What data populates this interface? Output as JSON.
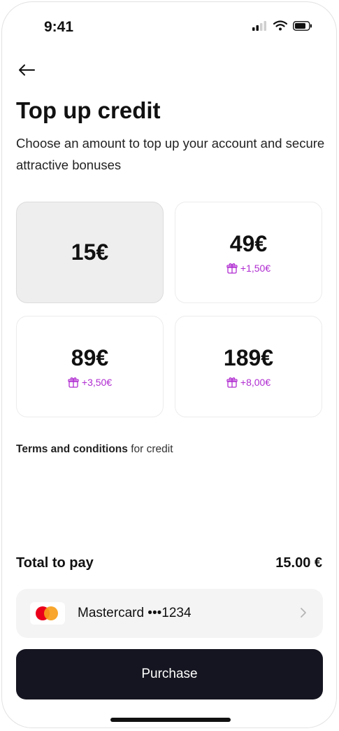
{
  "status_bar": {
    "time": "9:41"
  },
  "header": {
    "title": "Top up credit",
    "subtitle": "Choose an amount to top up your account and secure attractive bonuses"
  },
  "options": [
    {
      "amount": "15€",
      "bonus": "",
      "selected": true
    },
    {
      "amount": "49€",
      "bonus": "+1,50€",
      "selected": false
    },
    {
      "amount": "89€",
      "bonus": "+3,50€",
      "selected": false
    },
    {
      "amount": "189€",
      "bonus": "+8,00€",
      "selected": false
    }
  ],
  "terms": {
    "link": "Terms and conditions",
    "suffix": " for credit"
  },
  "total": {
    "label": "Total to pay",
    "value": "15.00 €"
  },
  "payment": {
    "label": "Mastercard •••1234"
  },
  "purchase": {
    "label": "Purchase"
  },
  "colors": {
    "bonus": "#b02cd1",
    "button": "#141520",
    "selected_card": "#eeeeee"
  },
  "icons": [
    "back-arrow-icon",
    "gift-icon",
    "mastercard-logo",
    "chevron-right-icon",
    "signal-icon",
    "wifi-icon",
    "battery-icon"
  ]
}
